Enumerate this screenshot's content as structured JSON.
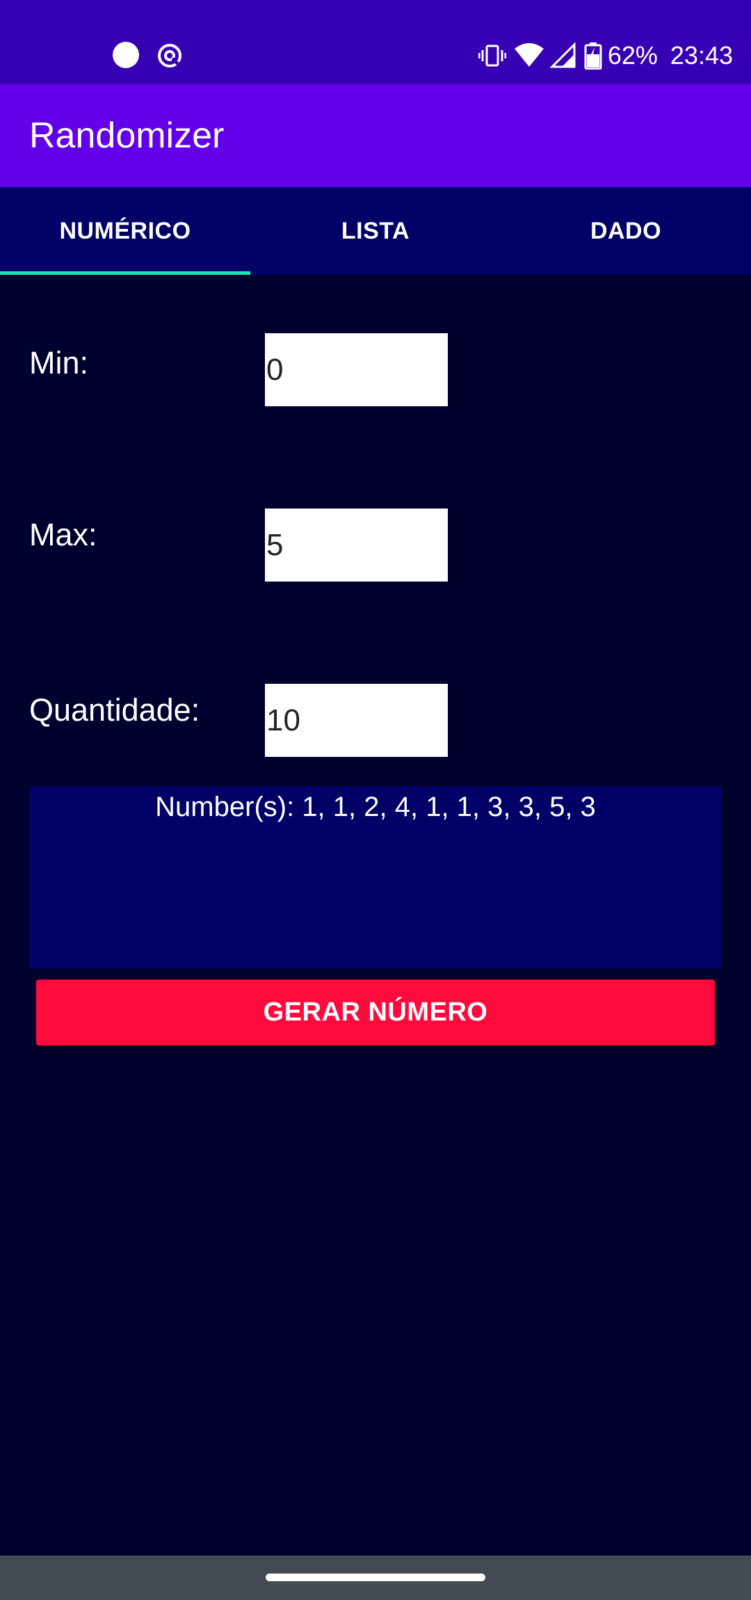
{
  "status_bar": {
    "battery_percent": "62%",
    "time": "23:43",
    "icons": [
      "notification-dot-icon",
      "sync-icon",
      "vibrate-icon",
      "wifi-icon",
      "cell-signal-icon",
      "battery-charging-icon"
    ]
  },
  "app_bar": {
    "title": "Randomizer"
  },
  "tabs": [
    {
      "label": "NUMÉRICO",
      "selected": true
    },
    {
      "label": "LISTA",
      "selected": false
    },
    {
      "label": "DADO",
      "selected": false
    }
  ],
  "form": {
    "min": {
      "label": "Min:",
      "value": "0"
    },
    "max": {
      "label": "Max:",
      "value": "5"
    },
    "quantity": {
      "label": "Quantidade:",
      "value": "10"
    }
  },
  "result": {
    "text": "Number(s): 1, 1, 2, 4, 1, 1, 3, 3, 5, 3"
  },
  "generate_button": {
    "label": "GERAR NÚMERO"
  },
  "colors": {
    "status_bar": "#3700b3",
    "app_bar": "#6200ea",
    "tab_bar": "#000066",
    "tab_indicator": "#1de9b6",
    "background": "#00002e",
    "button": "#ff0a3c"
  }
}
